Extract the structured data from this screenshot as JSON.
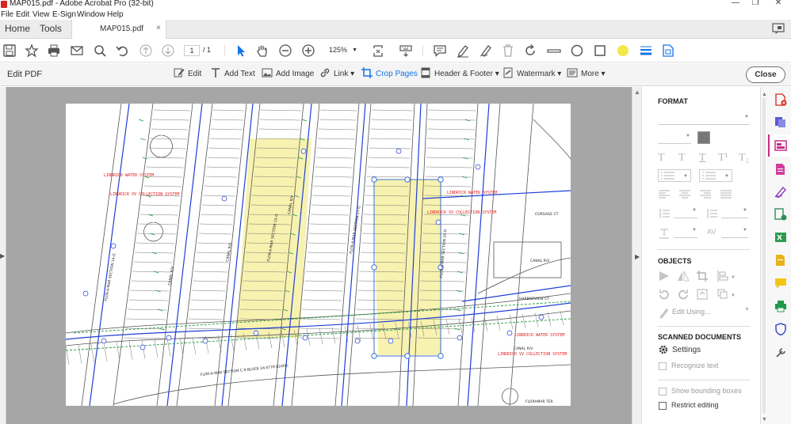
{
  "window": {
    "title": "MAP015.pdf - Adobe Acrobat Pro (32-bit)",
    "controls": [
      "—",
      "❐",
      "✕"
    ]
  },
  "menu": [
    "File",
    "Edit",
    "View",
    "E-Sign",
    "Window",
    "Help"
  ],
  "tabs": {
    "home": "Home",
    "tools": "Tools",
    "document": "MAP015.pdf",
    "close": "×"
  },
  "toolbar": {
    "page_current": "1",
    "page_total": "/ 1",
    "zoom": "125%"
  },
  "editbar": {
    "title": "Edit PDF",
    "tools": [
      {
        "label": "Edit",
        "icon": "edit-icon"
      },
      {
        "label": "Add Text",
        "icon": "add-text-icon"
      },
      {
        "label": "Add Image",
        "icon": "add-image-icon"
      },
      {
        "label": "Link ▾",
        "icon": "link-icon"
      },
      {
        "label": "Crop Pages",
        "icon": "crop-icon",
        "active": true
      },
      {
        "label": "Header & Footer ▾",
        "icon": "header-footer-icon"
      },
      {
        "label": "Watermark ▾",
        "icon": "watermark-icon"
      },
      {
        "label": "More ▾",
        "icon": "more-icon"
      }
    ],
    "close_label": "Close",
    "accent_color": "#1473e6"
  },
  "panel": {
    "format_heading": "FORMAT",
    "objects_heading": "OBJECTS",
    "edit_using": "Edit Using...",
    "scanned_heading": "SCANNED DOCUMENTS",
    "settings": "Settings",
    "recognize_text": "Recognize text",
    "show_bounding": "Show bounding boxes",
    "restrict_editing": "Restrict editing",
    "av_label": "AV",
    "text_style_glyphs": [
      "T",
      "T",
      "T",
      "T¹",
      "T₁"
    ]
  },
  "map": {
    "labels": {
      "water_system_1": "LINDRICK WATER SYSTEM",
      "collection_1": "LINDRICK VV COLLECTION SYSTEM",
      "water_system_2": "LINDRICK WATER SYSTEM",
      "collection_2": "LINDRICK VV COLLECTION SYSTEM",
      "water_system_3": "LINDRICK WATER SYSTEM",
      "collection_3": "LINDRICK VV COLLECTION SYSTEM",
      "canal_1": "CANAL R/V",
      "canal_2": "CANAL R/V",
      "canal_3": "CANAL R/V",
      "canal_4": "CANAL R/V",
      "canal_5": "CANAL R/V",
      "section_1": "FLOR-A-MAR SECTION 14-G",
      "section_2": "FLOR-A-MAR SECTION 15-G",
      "section_3": "FLOR-A-MAR SECTION 17-G",
      "section_4": "FLOR-A-MAR SECTION 16-G",
      "bottom_section": "FLOR-A-MAR SECTION C-9 BLOCK 24 0778-02400-",
      "corsage": "CORSAGE CT",
      "harbor": "HARBORVIEW CT",
      "floramar": "FLORAMAR TER"
    },
    "accent_red": "#e0201e",
    "line_blue": "#1f3fd6",
    "highlight": "#f8f2b0"
  },
  "colors": {
    "close_border": "#707070",
    "rail_accent": "#c62d83"
  }
}
